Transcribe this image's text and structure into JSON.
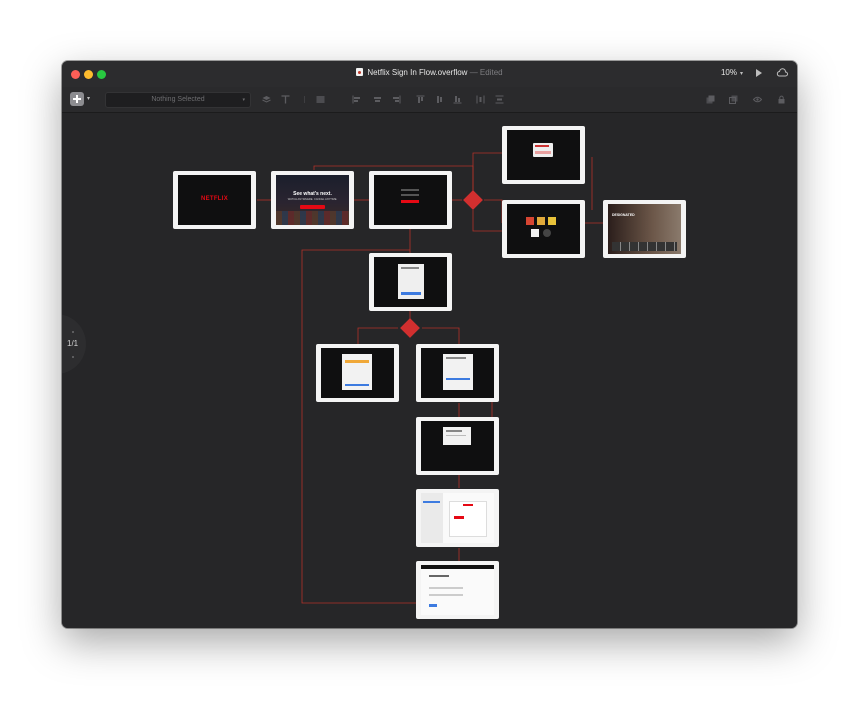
{
  "window": {
    "title": "Netflix Sign In Flow.overflow",
    "edited": "— Edited",
    "zoom": "10%",
    "zoom_caret": "▾"
  },
  "toolbar": {
    "add_caret": "▾",
    "selection": "Nothing Selected",
    "selection_caret": "▾"
  },
  "canvas": {
    "page_indicator": "1/1"
  },
  "boards": {
    "splash": {
      "logo": "NETFLIX"
    },
    "welcome": {
      "headline": "See what's next.",
      "subline": "WATCH ANYWHERE. CANCEL ANYTIME."
    },
    "profile": {
      "hero_title": "DESIGNATED"
    }
  },
  "colors": {
    "window_bg": "#262628",
    "link_red": "#c0392b",
    "netflix_red": "#e50914",
    "accent_blue": "#3d7be0"
  },
  "icons": [
    "plus-icon",
    "stack-icon",
    "text-icon",
    "align-left-icon",
    "align-center-icon",
    "align-right-icon",
    "align-top-icon",
    "align-middle-icon",
    "align-bottom-icon",
    "distribute-h-icon",
    "distribute-v-icon",
    "bring-front-icon",
    "send-back-icon",
    "eye-icon",
    "lock-icon",
    "play-icon",
    "cloud-icon"
  ]
}
